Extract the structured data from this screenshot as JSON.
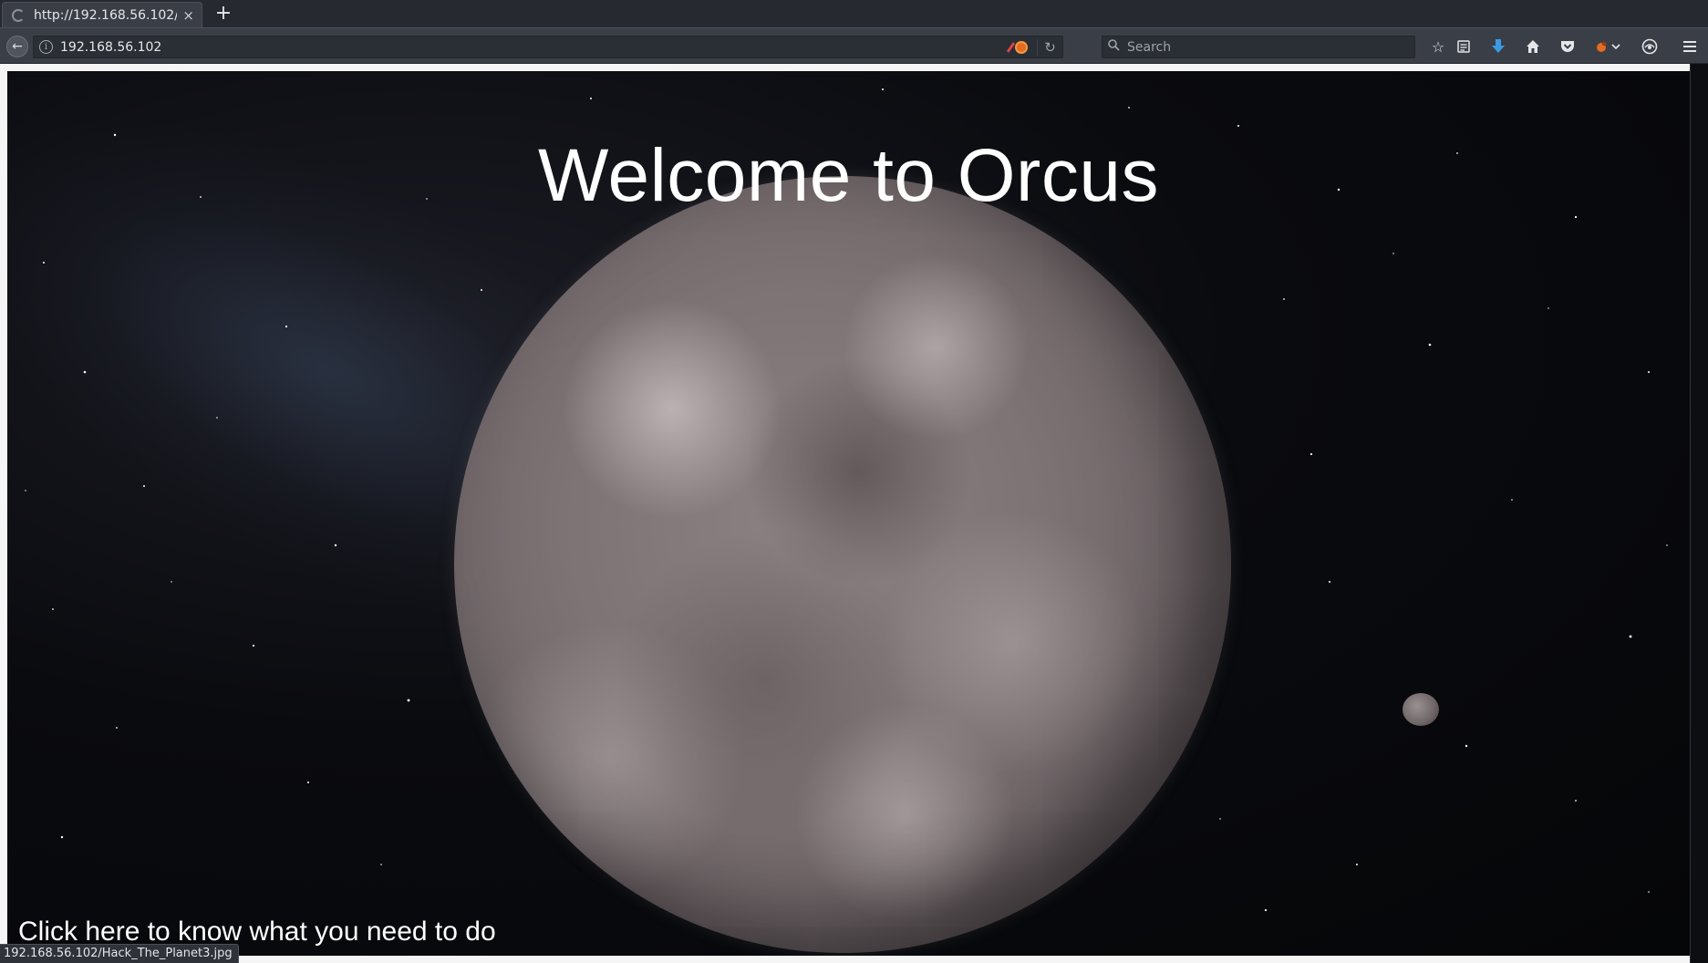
{
  "browser": {
    "tab": {
      "title": "http://192.168.56.102/",
      "close_glyph": "×"
    },
    "new_tab_glyph": "+",
    "back_glyph": "←",
    "url": "192.168.56.102",
    "info_glyph": "i",
    "reload_glyph": "↻",
    "search": {
      "placeholder": "Search"
    },
    "toolbar_icons": [
      "star-icon",
      "reading-list-icon",
      "download-icon",
      "home-icon",
      "pocket-icon",
      "extension-icon",
      "chevron-down-icon",
      "privacy-icon",
      "menu-icon"
    ],
    "toolbar_glyphs": {
      "star": "☆",
      "reading_list": "▤",
      "download": "⬇",
      "home": "⌂",
      "pocket": "◙",
      "extension": "●",
      "chevron": "⌄",
      "privacy": "◍",
      "menu": "≡"
    },
    "status_text": "192.168.56.102/Hack_The_Planet3.jpg"
  },
  "page": {
    "heading": "Welcome to Orcus",
    "link_text": "Click here to know what you need to do"
  },
  "colors": {
    "chrome_bg": "#3a3f47",
    "tab_strip_bg": "#262a30",
    "download_accent": "#3b9ae1",
    "extension_accent": "#e46b1f",
    "page_text": "#ffffff",
    "space_bg": "#0a0b0f"
  }
}
